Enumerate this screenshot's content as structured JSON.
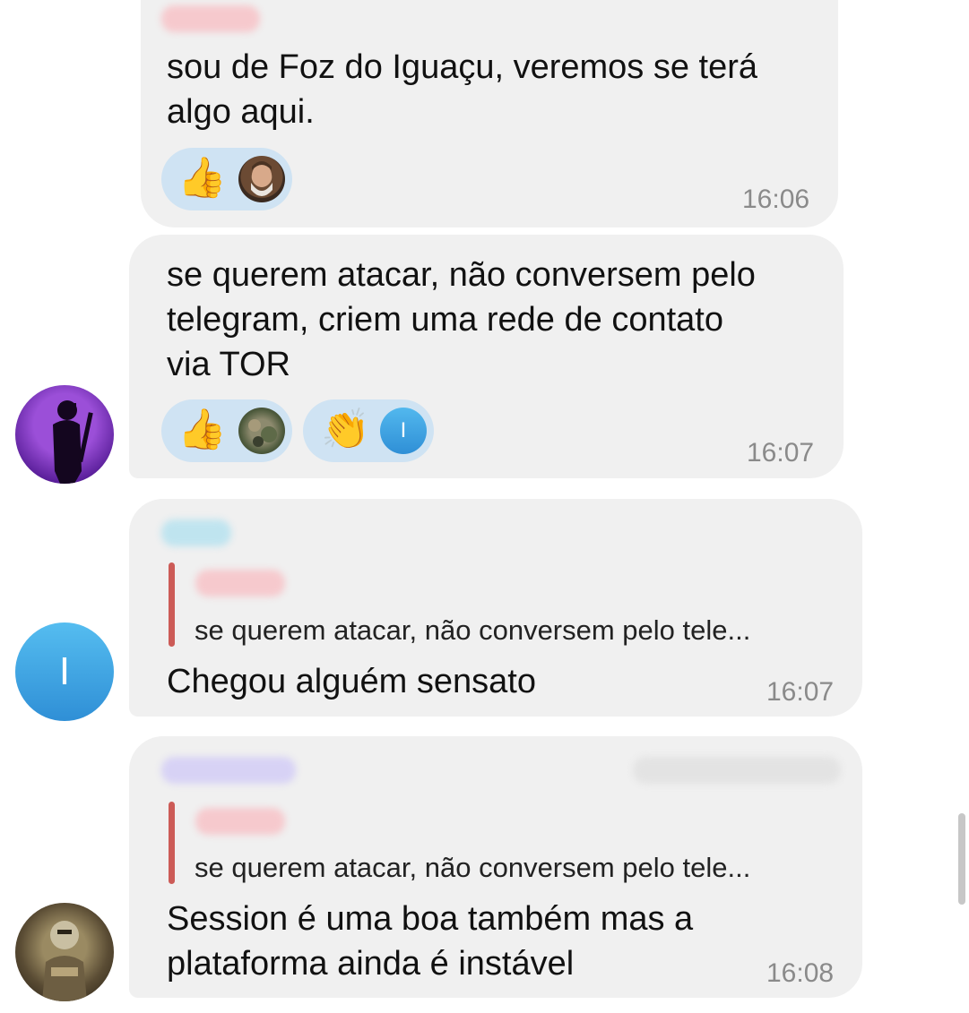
{
  "messages": [
    {
      "text": "sou de Foz do Iguaçu, veremos se terá\nalgo aqui.",
      "time": "16:06",
      "reactions": [
        {
          "emoji": "👍",
          "icon": "thumbs-up-emoji"
        }
      ]
    },
    {
      "text": "se querem atacar, não conversem pelo\ntelegram, criem uma rede de contato\nvia TOR",
      "time": "16:07",
      "reactions": [
        {
          "emoji": "👍",
          "icon": "thumbs-up-emoji"
        },
        {
          "emoji": "👏",
          "icon": "clapping-hands-emoji",
          "avatar_letter": "I"
        }
      ]
    },
    {
      "reply_quote": "se querem atacar, não conversem pelo tele...",
      "text": "Chegou alguém sensato",
      "time": "16:07",
      "avatar_letter": "I"
    },
    {
      "reply_quote": "se querem atacar, não conversem pelo tele...",
      "text": "Session é uma boa também mas a\nplataforma ainda é instável",
      "time": "16:08"
    }
  ],
  "colors": {
    "bubble": "#f0f0f0",
    "reaction_pill": "#cfe3f3",
    "reply_bar": "#cc5b57",
    "time": "#8a8a8a",
    "letter_avatar": "#3ba3e0"
  }
}
